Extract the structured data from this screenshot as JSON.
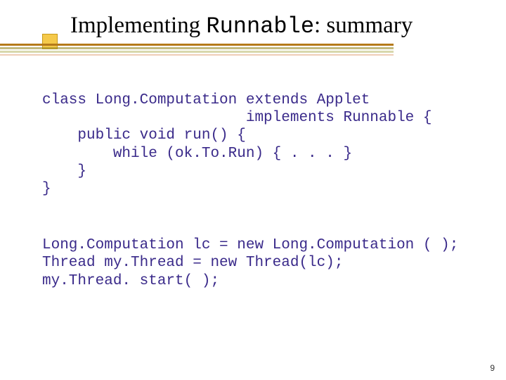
{
  "title": {
    "part1": "Implementing ",
    "code": "Runnable",
    "part2": ": summary"
  },
  "code_block1": "class Long.Computation extends Applet\n                       implements Runnable {\n    public void run() {\n        while (ok.To.Run) { . . . }\n    }\n}",
  "code_block2": "Long.Computation lc = new Long.Computation ( );\nThread my.Thread = new Thread(lc);\nmy.Thread. start( );",
  "page_number": "9"
}
